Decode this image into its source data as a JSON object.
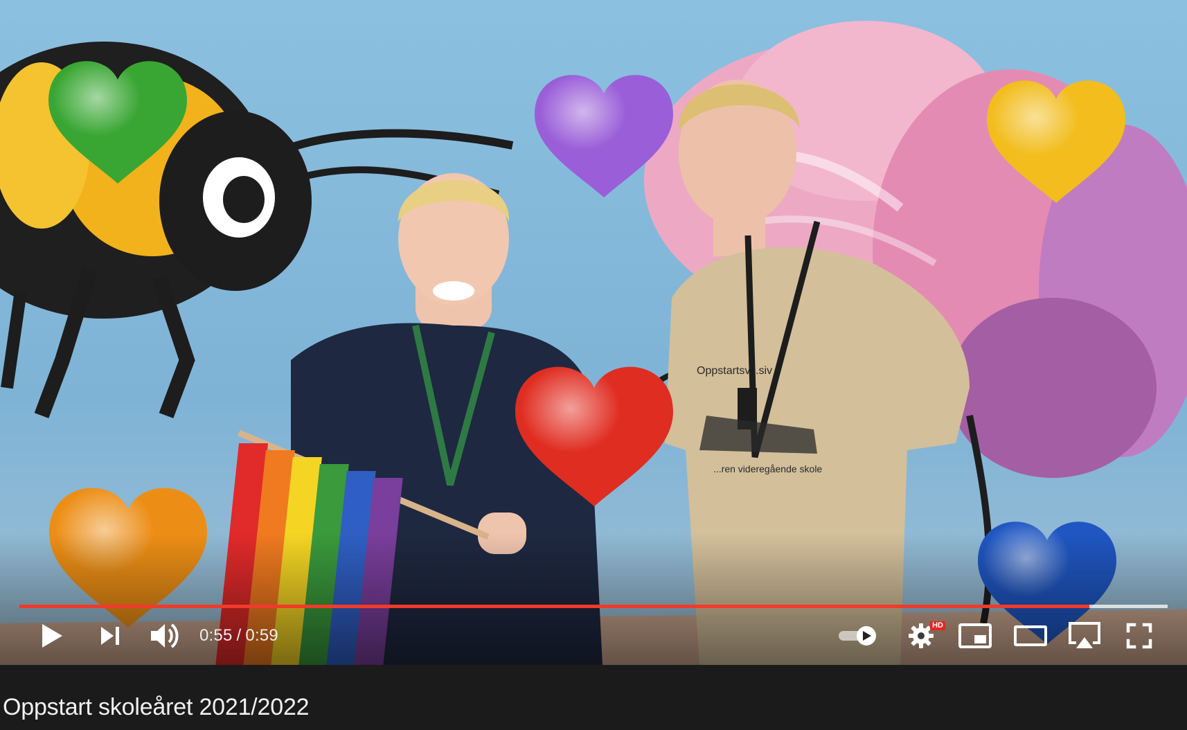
{
  "player": {
    "time": {
      "current": "0:55",
      "separator": "/",
      "duration": "0:59"
    },
    "progress": {
      "played_fraction": 0.932,
      "loaded_fraction": 1.0,
      "played_color": "#f03a2a"
    },
    "controls": {
      "play_icon": "play-icon",
      "next_icon": "skip-next-icon",
      "volume_icon": "volume-icon",
      "autoplay_icon": "autoplay-toggle-icon",
      "settings_icon": "gear-icon",
      "settings_badge": "HD",
      "miniplayer_icon": "miniplayer-icon",
      "theater_icon": "theater-mode-icon",
      "airplay_icon": "airplay-icon",
      "fullscreen_icon": "fullscreen-icon"
    }
  },
  "video": {
    "title": "Oppstart skoleåret 2021/2022",
    "shirt_text_top": "Oppstartsv...siv",
    "shirt_text_bottom": "...ren videregående skole"
  },
  "colors": {
    "accent": "#f03a2a",
    "hd_badge": "#e2271e",
    "background": "#1b1b1b"
  }
}
